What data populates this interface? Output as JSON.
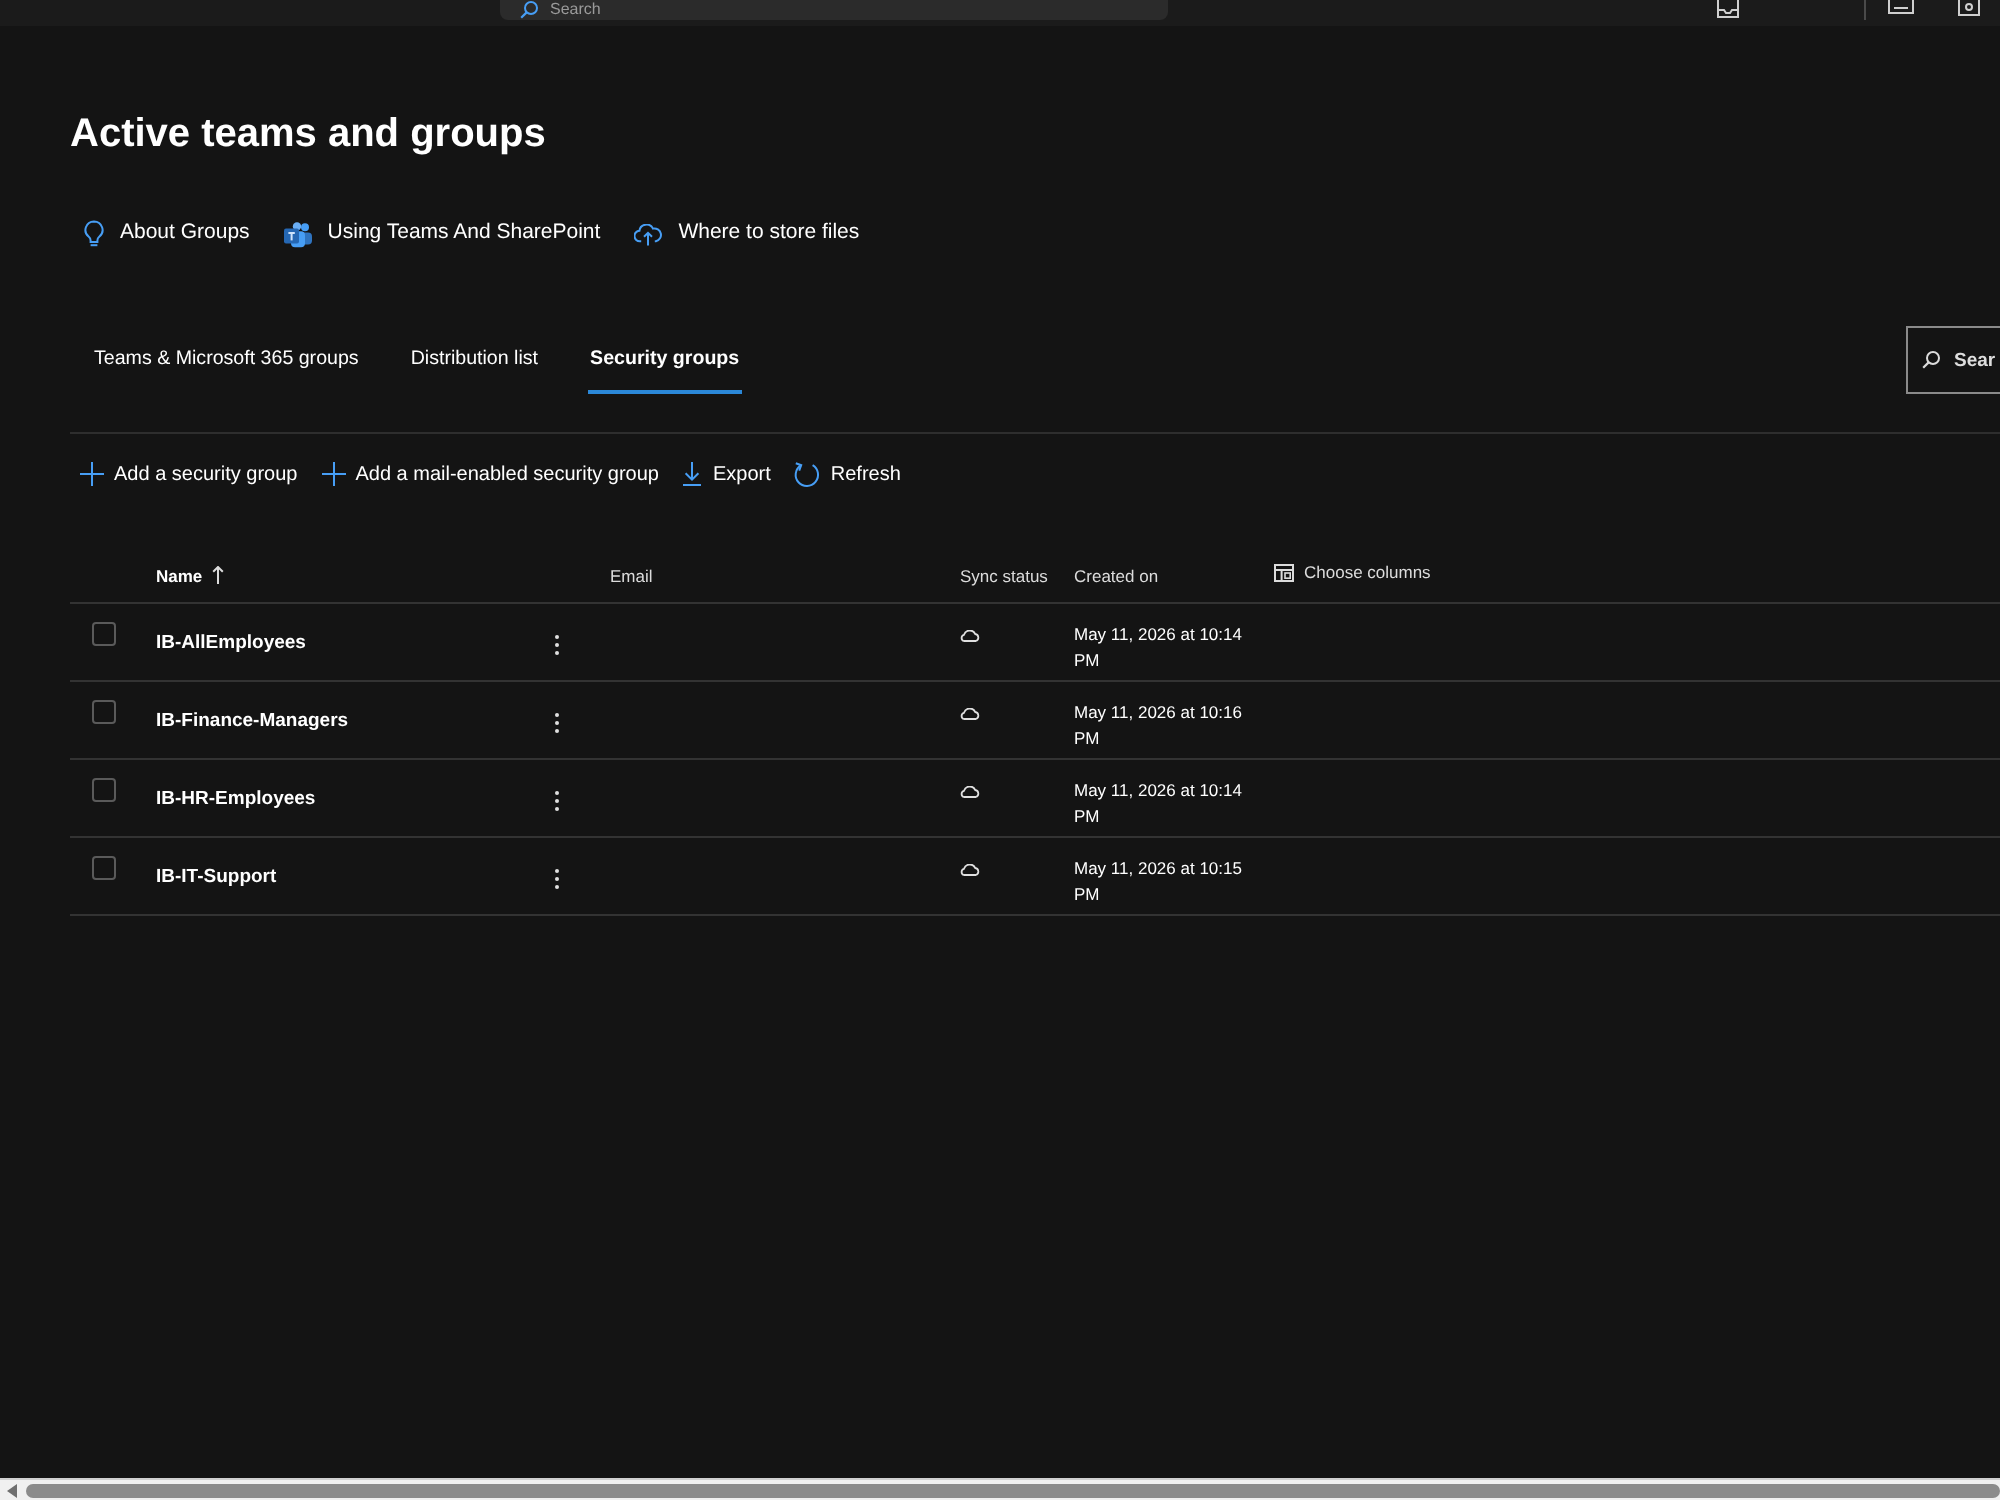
{
  "top_bar": {
    "search": {
      "placeholder": "Search"
    }
  },
  "page": {
    "title": "Active teams and groups"
  },
  "help_links": [
    {
      "label": "About Groups"
    },
    {
      "label": "Using Teams And SharePoint"
    },
    {
      "label": "Where to store files"
    }
  ],
  "tabs": [
    {
      "label": "Teams & Microsoft 365 groups",
      "selected": false
    },
    {
      "label": "Distribution list",
      "selected": false
    },
    {
      "label": "Security groups",
      "selected": true
    }
  ],
  "search_box": {
    "placeholder": "Sear"
  },
  "toolbar": [
    {
      "label": "Add a security group"
    },
    {
      "label": "Add a mail-enabled security group"
    },
    {
      "label": "Export"
    },
    {
      "label": "Refresh"
    }
  ],
  "table": {
    "columns": [
      {
        "label": "Name",
        "sorted": true
      },
      {
        "label": "Email",
        "sorted": false
      },
      {
        "label": "Sync status",
        "sorted": false
      },
      {
        "label": "Created on",
        "sorted": false
      }
    ],
    "choose_columns": "Choose columns",
    "rows": [
      {
        "selected": false,
        "name": "IB-AllEmployees",
        "cloud_synced": true,
        "created_on": "May 11, 2026 at 10:14 PM"
      },
      {
        "selected": false,
        "name": "IB-Finance-Managers",
        "cloud_synced": true,
        "created_on": "May 11, 2026 at 10:16 PM"
      },
      {
        "selected": false,
        "name": "IB-HR-Employees",
        "cloud_synced": true,
        "created_on": "May 11, 2026 at 10:14 PM"
      },
      {
        "selected": false,
        "name": "IB-IT-Support",
        "cloud_synced": true,
        "created_on": "May 11, 2026 at 10:15 PM"
      }
    ]
  }
}
